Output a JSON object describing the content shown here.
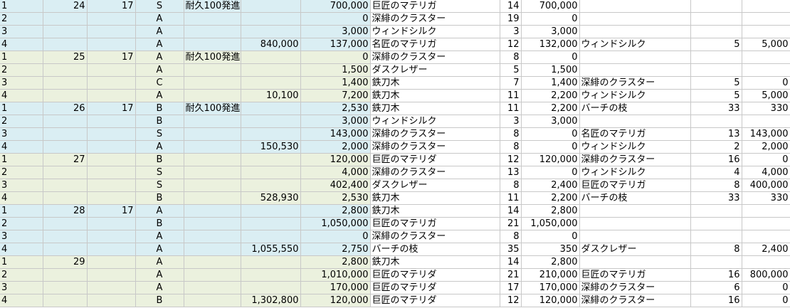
{
  "rows": [
    {
      "band": "blue",
      "a": "1",
      "b": "24",
      "c": "17",
      "d": "S",
      "e": "耐久100発進",
      "f": "",
      "g": "700,000",
      "h": "巨匠のマテリガ",
      "i": "14",
      "j": "700,000",
      "k": "",
      "l": "",
      "m": ""
    },
    {
      "band": "blue",
      "a": "2",
      "b": "",
      "c": "",
      "d": "A",
      "e": "",
      "f": "",
      "g": "0",
      "h": "深緋のクラスター",
      "i": "19",
      "j": "0",
      "k": "",
      "l": "",
      "m": ""
    },
    {
      "band": "blue",
      "a": "3",
      "b": "",
      "c": "",
      "d": "A",
      "e": "",
      "f": "",
      "g": "3,000",
      "h": "ウィンドシルク",
      "i": "3",
      "j": "3,000",
      "k": "",
      "l": "",
      "m": ""
    },
    {
      "band": "blue",
      "a": "4",
      "b": "",
      "c": "",
      "d": "A",
      "e": "",
      "f": "840,000",
      "g": "137,000",
      "h": "名匠のマテリガ",
      "i": "12",
      "j": "132,000",
      "k": "ウィンドシルク",
      "l": "5",
      "m": "5,000"
    },
    {
      "band": "green",
      "a": "1",
      "b": "25",
      "c": "17",
      "d": "A",
      "e": "耐久100発進",
      "f": "",
      "g": "0",
      "h": "深緋のクラスター",
      "i": "8",
      "j": "0",
      "k": "",
      "l": "",
      "m": ""
    },
    {
      "band": "green",
      "a": "2",
      "b": "",
      "c": "",
      "d": "A",
      "e": "",
      "f": "",
      "g": "1,500",
      "h": "ダスクレザー",
      "i": "5",
      "j": "1,500",
      "k": "",
      "l": "",
      "m": ""
    },
    {
      "band": "green",
      "a": "3",
      "b": "",
      "c": "",
      "d": "C",
      "e": "",
      "f": "",
      "g": "1,400",
      "h": "鉄刀木",
      "i": "7",
      "j": "1,400",
      "k": "深緋のクラスター",
      "l": "5",
      "m": "0"
    },
    {
      "band": "green",
      "a": "4",
      "b": "",
      "c": "",
      "d": "A",
      "e": "",
      "f": "10,100",
      "g": "7,200",
      "h": "鉄刀木",
      "i": "11",
      "j": "2,200",
      "k": "ウィンドシルク",
      "l": "5",
      "m": "5,000"
    },
    {
      "band": "blue",
      "a": "1",
      "b": "26",
      "c": "17",
      "d": "B",
      "e": "耐久100発進",
      "f": "",
      "g": "2,530",
      "h": "鉄刀木",
      "i": "11",
      "j": "2,200",
      "k": "バーチの枝",
      "l": "33",
      "m": "330"
    },
    {
      "band": "blue",
      "a": "2",
      "b": "",
      "c": "",
      "d": "B",
      "e": "",
      "f": "",
      "g": "3,000",
      "h": "ウィンドシルク",
      "i": "3",
      "j": "3,000",
      "k": "",
      "l": "",
      "m": ""
    },
    {
      "band": "blue",
      "a": "3",
      "b": "",
      "c": "",
      "d": "S",
      "e": "",
      "f": "",
      "g": "143,000",
      "h": "深緋のクラスター",
      "i": "8",
      "j": "0",
      "k": "名匠のマテリガ",
      "l": "13",
      "m": "143,000"
    },
    {
      "band": "blue",
      "a": "4",
      "b": "",
      "c": "",
      "d": "A",
      "e": "",
      "f": "150,530",
      "g": "2,000",
      "h": "深緋のクラスター",
      "i": "8",
      "j": "0",
      "k": "ウィンドシルク",
      "l": "2",
      "m": "2,000"
    },
    {
      "band": "green",
      "a": "1",
      "b": "27",
      "c": "",
      "d": "B",
      "e": "",
      "f": "",
      "g": "120,000",
      "h": "巨匠のマテリダ",
      "i": "12",
      "j": "120,000",
      "k": "深緋のクラスター",
      "l": "16",
      "m": "0"
    },
    {
      "band": "green",
      "a": "2",
      "b": "",
      "c": "",
      "d": "S",
      "e": "",
      "f": "",
      "g": "4,000",
      "h": "深緋のクラスター",
      "i": "13",
      "j": "0",
      "k": "ウィンドシルク",
      "l": "4",
      "m": "4,000"
    },
    {
      "band": "green",
      "a": "3",
      "b": "",
      "c": "",
      "d": "S",
      "e": "",
      "f": "",
      "g": "402,400",
      "h": "ダスクレザー",
      "i": "8",
      "j": "2,400",
      "k": "巨匠のマテリガ",
      "l": "8",
      "m": "400,000"
    },
    {
      "band": "green",
      "a": "4",
      "b": "",
      "c": "",
      "d": "B",
      "e": "",
      "f": "528,930",
      "g": "2,530",
      "h": "鉄刀木",
      "i": "11",
      "j": "2,200",
      "k": "バーチの枝",
      "l": "33",
      "m": "330"
    },
    {
      "band": "blue",
      "a": "1",
      "b": "28",
      "c": "17",
      "d": "A",
      "e": "",
      "f": "",
      "g": "2,800",
      "h": "鉄刀木",
      "i": "14",
      "j": "2,800",
      "k": "",
      "l": "",
      "m": ""
    },
    {
      "band": "blue",
      "a": "2",
      "b": "",
      "c": "",
      "d": "B",
      "e": "",
      "f": "",
      "g": "1,050,000",
      "h": "巨匠のマテリガ",
      "i": "21",
      "j": "1,050,000",
      "k": "",
      "l": "",
      "m": ""
    },
    {
      "band": "blue",
      "a": "3",
      "b": "",
      "c": "",
      "d": "A",
      "e": "",
      "f": "",
      "g": "0",
      "h": "深緋のクラスター",
      "i": "8",
      "j": "0",
      "k": "",
      "l": "",
      "m": ""
    },
    {
      "band": "blue",
      "a": "4",
      "b": "",
      "c": "",
      "d": "A",
      "e": "",
      "f": "1,055,550",
      "g": "2,750",
      "h": "バーチの枝",
      "i": "35",
      "j": "350",
      "k": "ダスクレザー",
      "l": "8",
      "m": "2,400"
    },
    {
      "band": "green",
      "a": "1",
      "b": "29",
      "c": "",
      "d": "A",
      "e": "",
      "f": "",
      "g": "2,800",
      "h": "鉄刀木",
      "i": "14",
      "j": "2,800",
      "k": "",
      "l": "",
      "m": ""
    },
    {
      "band": "green",
      "a": "2",
      "b": "",
      "c": "",
      "d": "A",
      "e": "",
      "f": "",
      "g": "1,010,000",
      "h": "巨匠のマテリダ",
      "i": "21",
      "j": "210,000",
      "k": "巨匠のマテリガ",
      "l": "16",
      "m": "800,000"
    },
    {
      "band": "green",
      "a": "3",
      "b": "",
      "c": "",
      "d": "A",
      "e": "",
      "f": "",
      "g": "170,000",
      "h": "巨匠のマテリダ",
      "i": "17",
      "j": "170,000",
      "k": "深緋のクラスター",
      "l": "6",
      "m": "0"
    },
    {
      "band": "green",
      "a": "4",
      "b": "",
      "c": "",
      "d": "B",
      "e": "",
      "f": "1,302,800",
      "g": "120,000",
      "h": "巨匠のマテリダ",
      "i": "12",
      "j": "120,000",
      "k": "深緋のクラスター",
      "l": "16",
      "m": "0"
    }
  ]
}
